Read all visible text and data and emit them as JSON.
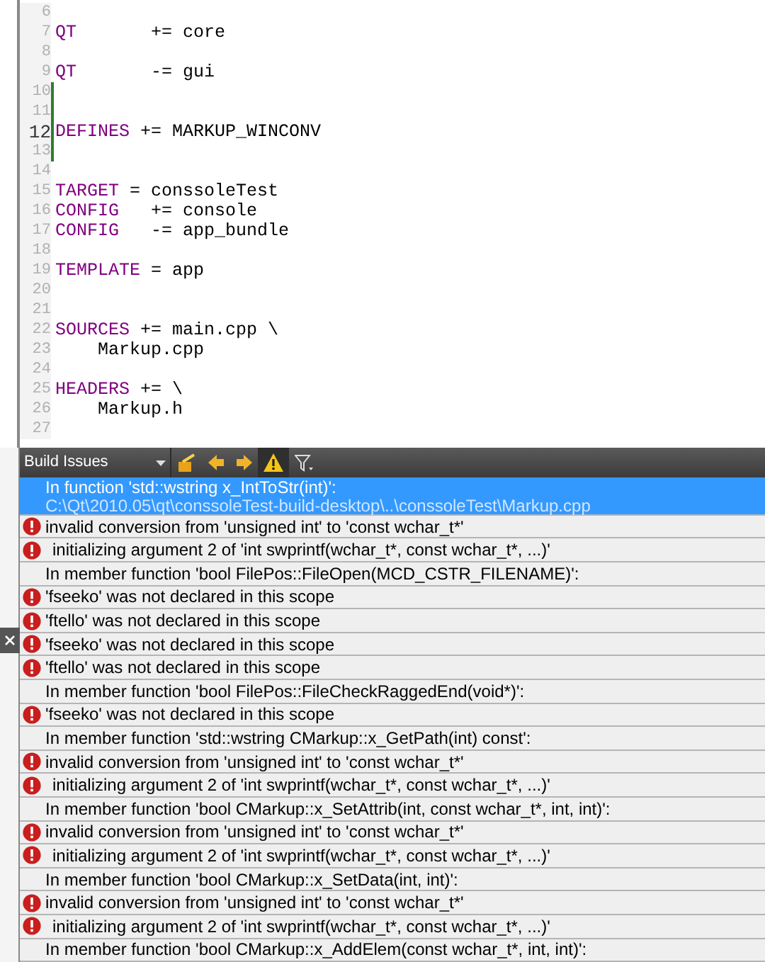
{
  "editor": {
    "lines": [
      {
        "number": "6",
        "changed": false,
        "current": false
      },
      {
        "number": "7",
        "keyword": "QT",
        "rest": "       += core",
        "changed": false,
        "current": false
      },
      {
        "number": "8",
        "changed": false,
        "current": false
      },
      {
        "number": "9",
        "keyword": "QT",
        "rest": "       -= gui",
        "changed": false,
        "current": false
      },
      {
        "number": "10",
        "changed": true,
        "current": false
      },
      {
        "number": "11",
        "changed": true,
        "current": false
      },
      {
        "number": "12",
        "keyword": "DEFINES",
        "rest": " += MARKUP_WINCONV",
        "changed": true,
        "current": true
      },
      {
        "number": "13",
        "changed": true,
        "current": false
      },
      {
        "number": "14",
        "changed": false,
        "current": false
      },
      {
        "number": "15",
        "keyword": "TARGET",
        "rest": " = conssoleTest",
        "changed": false,
        "current": false
      },
      {
        "number": "16",
        "keyword": "CONFIG",
        "rest": "   += console",
        "changed": false,
        "current": false
      },
      {
        "number": "17",
        "keyword": "CONFIG",
        "rest": "   -= app_bundle",
        "changed": false,
        "current": false
      },
      {
        "number": "18",
        "changed": false,
        "current": false
      },
      {
        "number": "19",
        "keyword": "TEMPLATE",
        "rest": " = app",
        "changed": false,
        "current": false
      },
      {
        "number": "20",
        "changed": false,
        "current": false
      },
      {
        "number": "21",
        "changed": false,
        "current": false
      },
      {
        "number": "22",
        "keyword": "SOURCES",
        "rest": " += main.cpp \\",
        "changed": false,
        "current": false
      },
      {
        "number": "23",
        "rest": "    Markup.cpp",
        "changed": false,
        "current": false
      },
      {
        "number": "24",
        "changed": false,
        "current": false
      },
      {
        "number": "25",
        "keyword": "HEADERS",
        "rest": " += \\",
        "changed": false,
        "current": false
      },
      {
        "number": "26",
        "rest": "    Markup.h",
        "changed": false,
        "current": false
      },
      {
        "number": "27",
        "changed": false,
        "current": false
      }
    ]
  },
  "panel": {
    "title": "Build Issues",
    "issues": [
      {
        "kind": "context",
        "text": "In function 'std::wstring x_IntToStr(int)':",
        "path": "C:\\Qt\\2010.05\\qt\\conssoleTest-build-desktop\\..\\conssoleTest\\Markup.cpp",
        "selected": true,
        "indented": false
      },
      {
        "kind": "error",
        "text": "invalid conversion from 'unsigned int' to 'const wchar_t*'",
        "selected": false,
        "indented": false
      },
      {
        "kind": "error",
        "text": "initializing argument 2 of 'int swprintf(wchar_t*, const wchar_t*, ...)'",
        "selected": false,
        "indented": true
      },
      {
        "kind": "context",
        "text": "In member function 'bool FilePos::FileOpen(MCD_CSTR_FILENAME)':",
        "selected": false,
        "indented": false
      },
      {
        "kind": "error",
        "text": "'fseeko' was not declared in this scope",
        "selected": false,
        "indented": false
      },
      {
        "kind": "error",
        "text": "'ftello' was not declared in this scope",
        "selected": false,
        "indented": false
      },
      {
        "kind": "error",
        "text": "'fseeko' was not declared in this scope",
        "selected": false,
        "indented": false
      },
      {
        "kind": "error",
        "text": "'ftello' was not declared in this scope",
        "selected": false,
        "indented": false
      },
      {
        "kind": "context",
        "text": "In member function 'bool FilePos::FileCheckRaggedEnd(void*)':",
        "selected": false,
        "indented": false
      },
      {
        "kind": "error",
        "text": "'fseeko' was not declared in this scope",
        "selected": false,
        "indented": false
      },
      {
        "kind": "context",
        "text": "In member function 'std::wstring CMarkup::x_GetPath(int) const':",
        "selected": false,
        "indented": false
      },
      {
        "kind": "error",
        "text": "invalid conversion from 'unsigned int' to 'const wchar_t*'",
        "selected": false,
        "indented": false
      },
      {
        "kind": "error",
        "text": "initializing argument 2 of 'int swprintf(wchar_t*, const wchar_t*, ...)'",
        "selected": false,
        "indented": true
      },
      {
        "kind": "context",
        "text": "In member function 'bool CMarkup::x_SetAttrib(int, const wchar_t*, int, int)':",
        "selected": false,
        "indented": false
      },
      {
        "kind": "error",
        "text": "invalid conversion from 'unsigned int' to 'const wchar_t*'",
        "selected": false,
        "indented": false
      },
      {
        "kind": "error",
        "text": "initializing argument 2 of 'int swprintf(wchar_t*, const wchar_t*, ...)'",
        "selected": false,
        "indented": true
      },
      {
        "kind": "context",
        "text": "In member function 'bool CMarkup::x_SetData(int, int)':",
        "selected": false,
        "indented": false
      },
      {
        "kind": "error",
        "text": "invalid conversion from 'unsigned int' to 'const wchar_t*'",
        "selected": false,
        "indented": false
      },
      {
        "kind": "error",
        "text": "initializing argument 2 of 'int swprintf(wchar_t*, const wchar_t*, ...)'",
        "selected": false,
        "indented": true
      },
      {
        "kind": "context",
        "text": "In member function 'bool CMarkup::x_AddElem(const wchar_t*, int, int)':",
        "selected": false,
        "indented": false
      }
    ]
  }
}
